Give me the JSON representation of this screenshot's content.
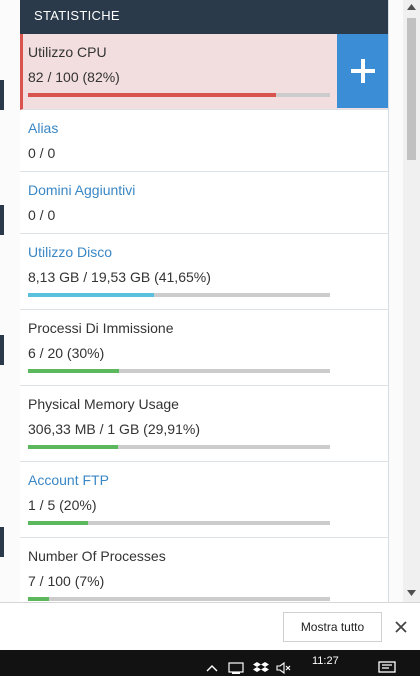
{
  "panel": {
    "header": "STATISTICHE",
    "stats": [
      {
        "name": "Utilizzo CPU",
        "value": "82 / 100   (82%)",
        "link": false,
        "alert": true,
        "bar": {
          "fraction": 0.82,
          "color": "#d9534f"
        }
      },
      {
        "name": "Alias",
        "value": "0 / 0",
        "link": true,
        "alert": false,
        "bar": null
      },
      {
        "name": "Domini Aggiuntivi",
        "value": "0 / 0",
        "link": true,
        "alert": false,
        "bar": null
      },
      {
        "name": "Utilizzo Disco",
        "value": "8,13 GB / 19,53 GB   (41,65%)",
        "link": true,
        "alert": false,
        "bar": {
          "fraction": 0.4165,
          "color": "#5bc0de"
        }
      },
      {
        "name": "Processi Di Immissione",
        "value": "6 / 20   (30%)",
        "link": false,
        "alert": false,
        "bar": {
          "fraction": 0.3,
          "color": "#5cb85c"
        }
      },
      {
        "name": "Physical Memory Usage",
        "value": "306,33 MB / 1 GB   (29,91%)",
        "link": false,
        "alert": false,
        "bar": {
          "fraction": 0.2991,
          "color": "#5cb85c"
        }
      },
      {
        "name": "Account FTP",
        "value": "1 / 5   (20%)",
        "link": true,
        "alert": false,
        "bar": {
          "fraction": 0.2,
          "color": "#5cb85c"
        }
      },
      {
        "name": "Number Of Processes",
        "value": "7 / 100   (7%)",
        "link": false,
        "alert": false,
        "bar": {
          "fraction": 0.07,
          "color": "#5cb85c"
        }
      }
    ],
    "expand_icon": "plus-icon"
  },
  "notification": {
    "show_all_label": "Mostra tutto",
    "close_icon": "close-icon"
  },
  "taskbar": {
    "time": "11:27",
    "tray_icons": [
      "chevron-up-icon",
      "network-icon",
      "dropbox-icon",
      "speaker-muted-icon",
      "notification-center-icon"
    ]
  }
}
